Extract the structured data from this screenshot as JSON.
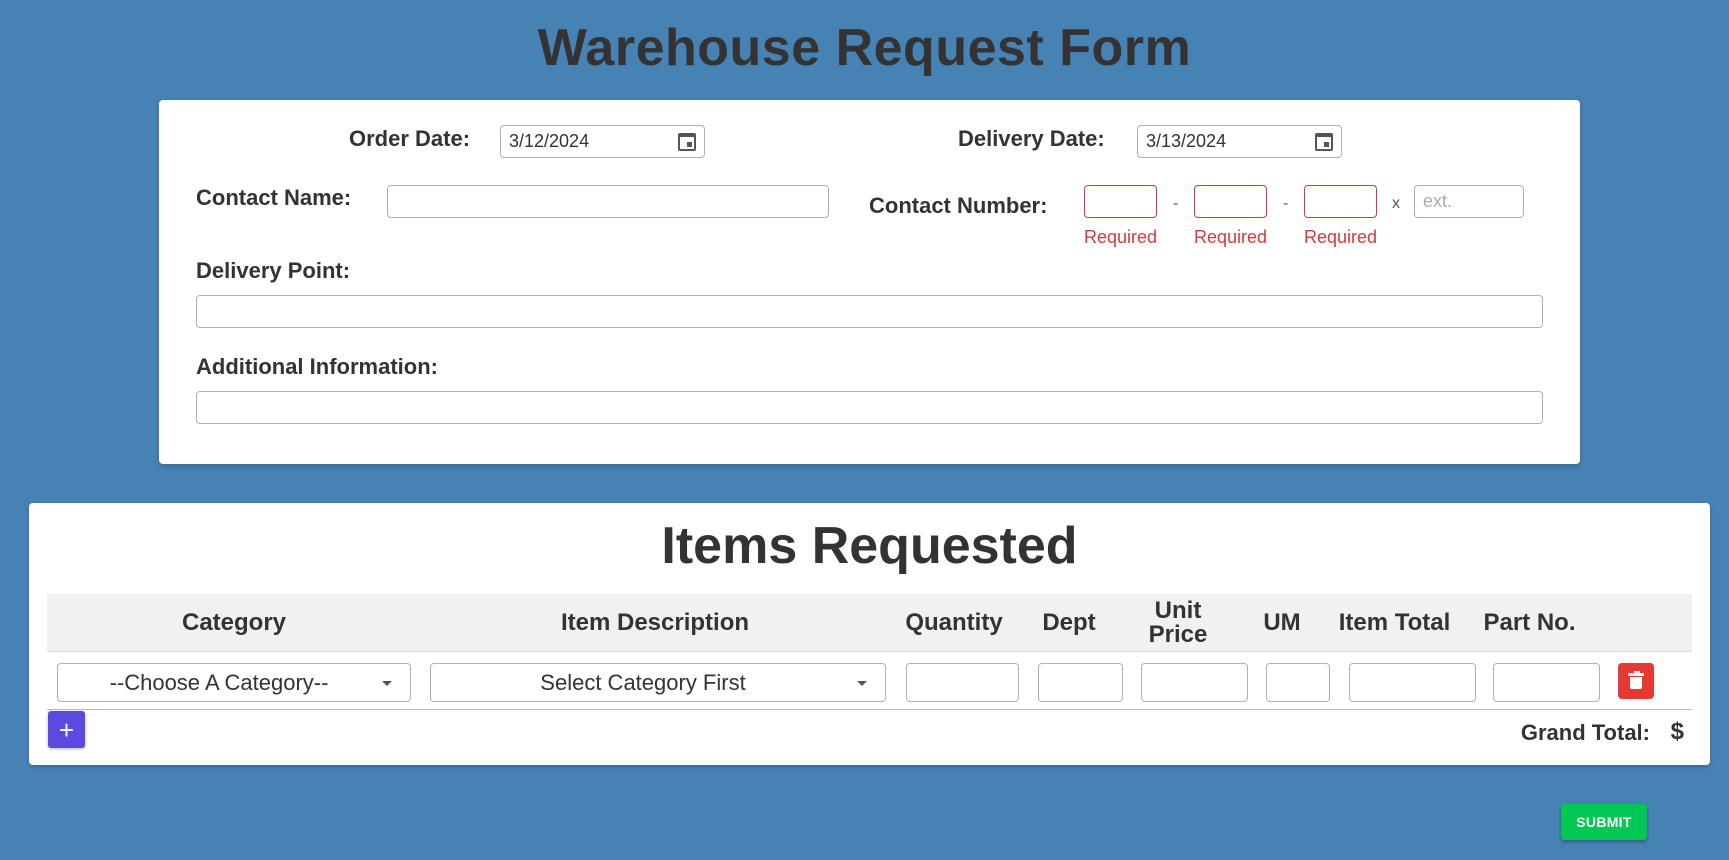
{
  "page_title": "Warehouse Request Form",
  "order_info": {
    "order_date_label": "Order Date:",
    "order_date_value": "3/12/2024",
    "delivery_date_label": "Delivery Date:",
    "delivery_date_value": "3/13/2024",
    "contact_name_label": "Contact Name:",
    "contact_name_value": "",
    "contact_number_label": "Contact Number:",
    "phone_separator": "-",
    "ext_separator": "x",
    "ext_placeholder": "ext.",
    "required_text": "Required",
    "delivery_point_label": "Delivery Point:",
    "delivery_point_value": "",
    "additional_info_label": "Additional Information:",
    "additional_info_value": ""
  },
  "items": {
    "title": "Items Requested",
    "columns": [
      "Category",
      "Item Description",
      "Quantity",
      "Dept",
      "Unit Price",
      "UM",
      "Item Total",
      "Part No."
    ],
    "row": {
      "category_value": "--Choose A Category--",
      "description_value": "Select Category First"
    },
    "add_label": "+",
    "grand_total_label": "Grand Total:",
    "grand_total_value": "$"
  },
  "submit_label": "SUBMIT",
  "colors": {
    "background": "#4682b4",
    "add_button": "#5b4ae0",
    "delete_button": "#e53935",
    "submit_button": "#00c853",
    "required": "#d23b3b"
  }
}
